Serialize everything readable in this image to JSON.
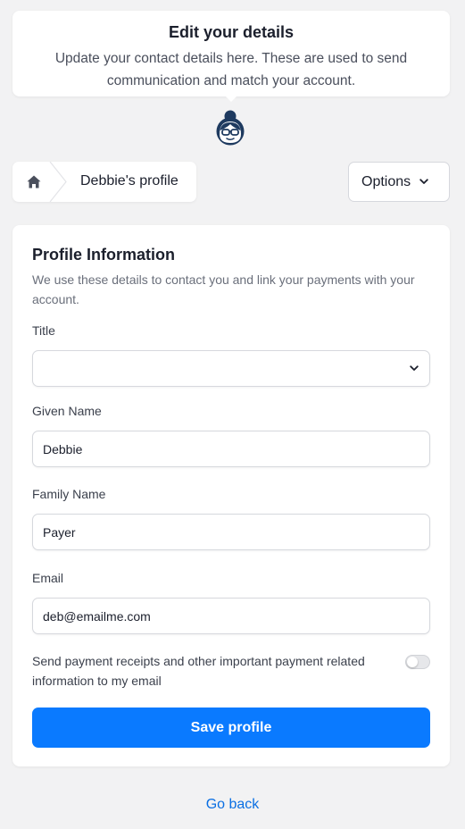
{
  "header": {
    "title": "Edit your details",
    "subtitle": "Update your contact details here. These are used to send communication and match your account."
  },
  "breadcrumb": {
    "home_icon": "home-icon",
    "label": "Debbie's profile"
  },
  "options": {
    "label": "Options"
  },
  "form": {
    "title": "Profile Information",
    "description": "We use these details to contact you and link your payments with your account.",
    "title_field": {
      "label": "Title",
      "value": ""
    },
    "given_name": {
      "label": "Given Name",
      "value": "Debbie"
    },
    "family_name": {
      "label": "Family Name",
      "value": "Payer"
    },
    "email": {
      "label": "Email",
      "value": "deb@emailme.com"
    },
    "consent": {
      "text": "Send payment receipts and other important payment related information to my email",
      "enabled": false
    },
    "save_label": "Save profile"
  },
  "footer": {
    "go_back": "Go back"
  },
  "colors": {
    "accent": "#0a7aff",
    "link": "#0a6fe3",
    "background": "#f2f2f3",
    "avatar": "#1e3a5f"
  }
}
